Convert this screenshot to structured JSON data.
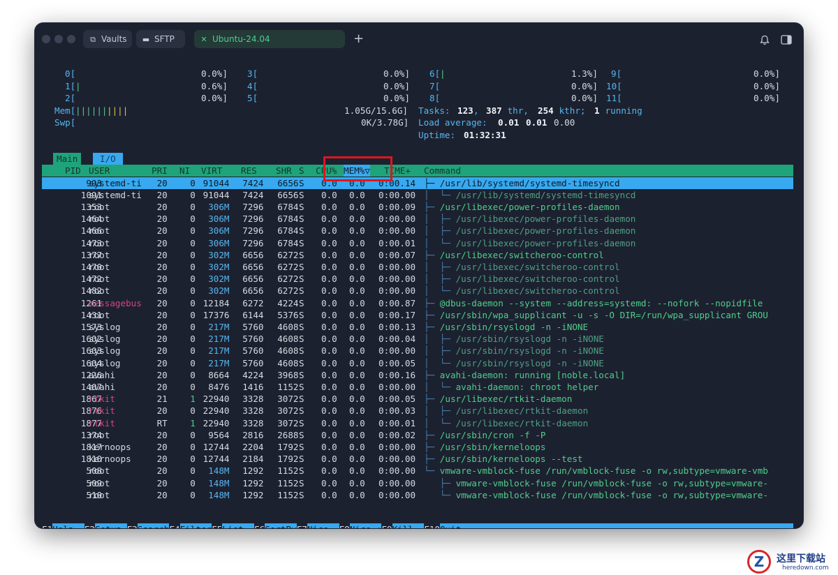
{
  "window": {
    "tabs": [
      {
        "label": "Vaults",
        "icon": "vaults-icon"
      },
      {
        "label": "SFTP",
        "icon": "folder-icon"
      },
      {
        "label": "Ubuntu-24.04",
        "icon": "close-icon"
      }
    ],
    "new_tab": "+",
    "bell_icon": "bell-icon",
    "sidebar_icon": "sidebar-toggle-icon"
  },
  "meters": {
    "cpus": [
      {
        "label": "0[",
        "bars": "",
        "value": "0.0%]"
      },
      {
        "label": "1[",
        "bars": "|",
        "value": "0.6%]"
      },
      {
        "label": "2[",
        "bars": "",
        "value": "0.0%]"
      },
      {
        "label": "3[",
        "bars": "",
        "value": "0.0%]"
      },
      {
        "label": "4[",
        "bars": "",
        "value": "0.0%]"
      },
      {
        "label": "5[",
        "bars": "",
        "value": "0.0%]"
      },
      {
        "label": "6[",
        "bars": "|",
        "value": "1.3%]"
      },
      {
        "label": "7[",
        "bars": "",
        "value": "0.0%]"
      },
      {
        "label": "8[",
        "bars": "",
        "value": "0.0%]"
      },
      {
        "label": "9[",
        "bars": "",
        "value": "0.0%]"
      },
      {
        "label": "10[",
        "bars": "",
        "value": "0.0%]"
      },
      {
        "label": "11[",
        "bars": "",
        "value": "0.0%]"
      }
    ],
    "mem": {
      "label": "Mem[",
      "bars_green": "||||||",
      "bars_yellow": "||||",
      "value": "1.05G/15.6G]"
    },
    "swp": {
      "label": "Swp[",
      "value": "0K/3.78G]"
    },
    "tasks": {
      "label": "Tasks:",
      "count": "123",
      "sep1": ",",
      "thr": "387",
      "thr_label": " thr,",
      "kthr": "254",
      "kthr_label": " kthr;",
      "running": "1",
      "running_label": " running"
    },
    "load": {
      "label": "Load average:",
      "v1": "0.01",
      "v2": "0.01",
      "v3": "0.00"
    },
    "uptime": {
      "label": "Uptime:",
      "value": "01:32:31"
    }
  },
  "screen_tabs": {
    "main": "Main",
    "io": "I/O"
  },
  "columns": [
    "PID",
    "USER",
    "PRI",
    "NI",
    "VIRT",
    "RES",
    "SHR",
    "S",
    "CPU%",
    "MEM%▽",
    "TIME+",
    "Command"
  ],
  "processes": [
    {
      "pid": "993",
      "user": "systemd-ti",
      "pri": "20",
      "ni": "0",
      "virt": "91044",
      "res": "7424",
      "shr": "6656",
      "s": "S",
      "cpu": "0.0",
      "mem": "0.0",
      "time": "0:00.14",
      "tree": "├─ ",
      "cmd": "/usr/lib/systemd/systemd-timesyncd",
      "selected": true
    },
    {
      "pid": "1091",
      "user": "systemd-ti",
      "pri": "20",
      "ni": "0",
      "virt": "91044",
      "res": "7424",
      "shr": "6656",
      "s": "S",
      "cpu": "0.0",
      "mem": "0.0",
      "time": "0:00.00",
      "tree": "│  └─ ",
      "cmd": "/usr/lib/systemd/systemd-timesyncd",
      "thread": true
    },
    {
      "pid": "1353",
      "user": "root",
      "pri": "20",
      "ni": "0",
      "virt": "306M",
      "res": "7296",
      "shr": "6784",
      "s": "S",
      "cpu": "0.0",
      "mem": "0.0",
      "time": "0:00.09",
      "tree": "├─ ",
      "cmd": "/usr/libexec/power-profiles-daemon"
    },
    {
      "pid": "1464",
      "user": "root",
      "pri": "20",
      "ni": "0",
      "virt": "306M",
      "res": "7296",
      "shr": "6784",
      "s": "S",
      "cpu": "0.0",
      "mem": "0.0",
      "time": "0:00.00",
      "tree": "│  ├─ ",
      "cmd": "/usr/libexec/power-profiles-daemon",
      "thread": true
    },
    {
      "pid": "1466",
      "user": "root",
      "pri": "20",
      "ni": "0",
      "virt": "306M",
      "res": "7296",
      "shr": "6784",
      "s": "S",
      "cpu": "0.0",
      "mem": "0.0",
      "time": "0:00.00",
      "tree": "│  ├─ ",
      "cmd": "/usr/libexec/power-profiles-daemon",
      "thread": true
    },
    {
      "pid": "1473",
      "user": "root",
      "pri": "20",
      "ni": "0",
      "virt": "306M",
      "res": "7296",
      "shr": "6784",
      "s": "S",
      "cpu": "0.0",
      "mem": "0.0",
      "time": "0:00.01",
      "tree": "│  └─ ",
      "cmd": "/usr/libexec/power-profiles-daemon",
      "thread": true
    },
    {
      "pid": "1377",
      "user": "root",
      "pri": "20",
      "ni": "0",
      "virt": "302M",
      "res": "6656",
      "shr": "6272",
      "s": "S",
      "cpu": "0.0",
      "mem": "0.0",
      "time": "0:00.07",
      "tree": "├─ ",
      "cmd": "/usr/libexec/switcheroo-control"
    },
    {
      "pid": "1470",
      "user": "root",
      "pri": "20",
      "ni": "0",
      "virt": "302M",
      "res": "6656",
      "shr": "6272",
      "s": "S",
      "cpu": "0.0",
      "mem": "0.0",
      "time": "0:00.00",
      "tree": "│  ├─ ",
      "cmd": "/usr/libexec/switcheroo-control",
      "thread": true
    },
    {
      "pid": "1472",
      "user": "root",
      "pri": "20",
      "ni": "0",
      "virt": "302M",
      "res": "6656",
      "shr": "6272",
      "s": "S",
      "cpu": "0.0",
      "mem": "0.0",
      "time": "0:00.00",
      "tree": "│  ├─ ",
      "cmd": "/usr/libexec/switcheroo-control",
      "thread": true
    },
    {
      "pid": "1482",
      "user": "root",
      "pri": "20",
      "ni": "0",
      "virt": "302M",
      "res": "6656",
      "shr": "6272",
      "s": "S",
      "cpu": "0.0",
      "mem": "0.0",
      "time": "0:00.00",
      "tree": "│  └─ ",
      "cmd": "/usr/libexec/switcheroo-control",
      "thread": true
    },
    {
      "pid": "1261",
      "user": "messagebus",
      "pri": "20",
      "ni": "0",
      "virt": "12184",
      "res": "6272",
      "shr": "4224",
      "s": "S",
      "cpu": "0.0",
      "mem": "0.0",
      "time": "0:00.87",
      "tree": "├─ ",
      "cmd": "@dbus-daemon --system --address=systemd: --nofork --nopidfile",
      "usercolor": "magenta"
    },
    {
      "pid": "1431",
      "user": "root",
      "pri": "20",
      "ni": "0",
      "virt": "17376",
      "res": "6144",
      "shr": "5376",
      "s": "S",
      "cpu": "0.0",
      "mem": "0.0",
      "time": "0:00.17",
      "tree": "├─ ",
      "cmd": "/usr/sbin/wpa_supplicant -u -s -O DIR=/run/wpa_supplicant GROU"
    },
    {
      "pid": "1573",
      "user": "syslog",
      "pri": "20",
      "ni": "0",
      "virt": "217M",
      "res": "5760",
      "shr": "4608",
      "s": "S",
      "cpu": "0.0",
      "mem": "0.0",
      "time": "0:00.13",
      "tree": "├─ ",
      "cmd": "/usr/sbin/rsyslogd -n -iNONE"
    },
    {
      "pid": "1602",
      "user": "syslog",
      "pri": "20",
      "ni": "0",
      "virt": "217M",
      "res": "5760",
      "shr": "4608",
      "s": "S",
      "cpu": "0.0",
      "mem": "0.0",
      "time": "0:00.04",
      "tree": "│  ├─ ",
      "cmd": "/usr/sbin/rsyslogd -n -iNONE",
      "thread": true
    },
    {
      "pid": "1603",
      "user": "syslog",
      "pri": "20",
      "ni": "0",
      "virt": "217M",
      "res": "5760",
      "shr": "4608",
      "s": "S",
      "cpu": "0.0",
      "mem": "0.0",
      "time": "0:00.00",
      "tree": "│  ├─ ",
      "cmd": "/usr/sbin/rsyslogd -n -iNONE",
      "thread": true
    },
    {
      "pid": "1604",
      "user": "syslog",
      "pri": "20",
      "ni": "0",
      "virt": "217M",
      "res": "5760",
      "shr": "4608",
      "s": "S",
      "cpu": "0.0",
      "mem": "0.0",
      "time": "0:00.05",
      "tree": "│  └─ ",
      "cmd": "/usr/sbin/rsyslogd -n -iNONE",
      "thread": true
    },
    {
      "pid": "1226",
      "user": "avahi",
      "pri": "20",
      "ni": "0",
      "virt": "8664",
      "res": "4224",
      "shr": "3968",
      "s": "S",
      "cpu": "0.0",
      "mem": "0.0",
      "time": "0:00.16",
      "tree": "├─ ",
      "cmd": "avahi-daemon: running [noble.local]"
    },
    {
      "pid": "1407",
      "user": "avahi",
      "pri": "20",
      "ni": "0",
      "virt": "8476",
      "res": "1416",
      "shr": "1152",
      "s": "S",
      "cpu": "0.0",
      "mem": "0.0",
      "time": "0:00.00",
      "tree": "│  └─ ",
      "cmd": "avahi-daemon: chroot helper"
    },
    {
      "pid": "1867",
      "user": "rtkit",
      "pri": "21",
      "ni": "1",
      "virt": "22940",
      "res": "3328",
      "shr": "3072",
      "s": "S",
      "cpu": "0.0",
      "mem": "0.0",
      "time": "0:00.05",
      "tree": "├─ ",
      "cmd": "/usr/libexec/rtkit-daemon",
      "usercolor": "magenta",
      "nicolor": "green"
    },
    {
      "pid": "1876",
      "user": "rtkit",
      "pri": "20",
      "ni": "0",
      "virt": "22940",
      "res": "3328",
      "shr": "3072",
      "s": "S",
      "cpu": "0.0",
      "mem": "0.0",
      "time": "0:00.03",
      "tree": "│  ├─ ",
      "cmd": "/usr/libexec/rtkit-daemon",
      "thread": true,
      "usercolor": "magenta"
    },
    {
      "pid": "1877",
      "user": "rtkit",
      "pri": "RT",
      "ni": "1",
      "virt": "22940",
      "res": "3328",
      "shr": "3072",
      "s": "S",
      "cpu": "0.0",
      "mem": "0.0",
      "time": "0:00.01",
      "tree": "│  └─ ",
      "cmd": "/usr/libexec/rtkit-daemon",
      "thread": true,
      "usercolor": "magenta",
      "nicolor": "green"
    },
    {
      "pid": "1374",
      "user": "root",
      "pri": "20",
      "ni": "0",
      "virt": "9564",
      "res": "2816",
      "shr": "2688",
      "s": "S",
      "cpu": "0.0",
      "mem": "0.0",
      "time": "0:00.02",
      "tree": "├─ ",
      "cmd": "/usr/sbin/cron -f -P"
    },
    {
      "pid": "1817",
      "user": "kernoops",
      "pri": "20",
      "ni": "0",
      "virt": "12744",
      "res": "2204",
      "shr": "1792",
      "s": "S",
      "cpu": "0.0",
      "mem": "0.0",
      "time": "0:00.00",
      "tree": "├─ ",
      "cmd": "/usr/sbin/kerneloops"
    },
    {
      "pid": "1810",
      "user": "kernoops",
      "pri": "20",
      "ni": "0",
      "virt": "12744",
      "res": "2184",
      "shr": "1792",
      "s": "S",
      "cpu": "0.0",
      "mem": "0.0",
      "time": "0:00.00",
      "tree": "├─ ",
      "cmd": "/usr/sbin/kerneloops --test"
    },
    {
      "pid": "508",
      "user": "root",
      "pri": "20",
      "ni": "0",
      "virt": "148M",
      "res": "1292",
      "shr": "1152",
      "s": "S",
      "cpu": "0.0",
      "mem": "0.0",
      "time": "0:00.00",
      "tree": "└─ ",
      "cmd": "vmware-vmblock-fuse /run/vmblock-fuse -o rw,subtype=vmware-vmb"
    },
    {
      "pid": "509",
      "user": "root",
      "pri": "20",
      "ni": "0",
      "virt": "148M",
      "res": "1292",
      "shr": "1152",
      "s": "S",
      "cpu": "0.0",
      "mem": "0.0",
      "time": "0:00.00",
      "tree": "   ├─ ",
      "cmd": "vmware-vmblock-fuse /run/vmblock-fuse -o rw,subtype=vmware-"
    },
    {
      "pid": "510",
      "user": "root",
      "pri": "20",
      "ni": "0",
      "virt": "148M",
      "res": "1292",
      "shr": "1152",
      "s": "S",
      "cpu": "0.0",
      "mem": "0.0",
      "time": "0:00.00",
      "tree": "   └─ ",
      "cmd": "vmware-vmblock-fuse /run/vmblock-fuse -o rw,subtype=vmware-"
    }
  ],
  "function_keys": [
    {
      "key": "F1",
      "label": "Help  "
    },
    {
      "key": "F2",
      "label": "Setup "
    },
    {
      "key": "F3",
      "label": "Search"
    },
    {
      "key": "F4",
      "label": "Filter"
    },
    {
      "key": "F5",
      "label": "List  "
    },
    {
      "key": "F6",
      "label": "SortBy"
    },
    {
      "key": "F7",
      "label": "Nice -"
    },
    {
      "key": "F8",
      "label": "Nice +"
    },
    {
      "key": "F9",
      "label": "Kill  "
    },
    {
      "key": "F10",
      "label": "Quit"
    }
  ],
  "watermark": {
    "cn": "这里下载站",
    "en": "heredown.com",
    "logo": "Z"
  }
}
